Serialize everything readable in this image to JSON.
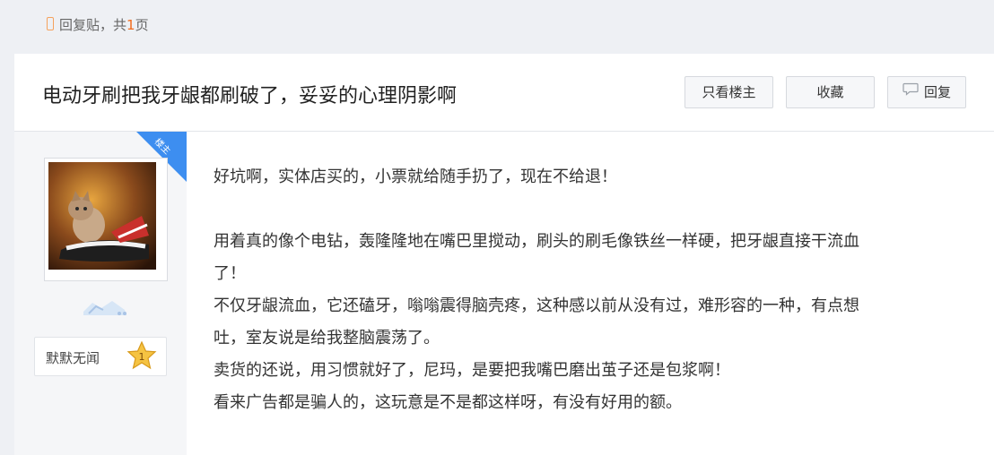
{
  "topbar": {
    "reply_prefix": "回复贴，共",
    "page_count": "1",
    "page_suffix": "页"
  },
  "post": {
    "title": "电动牙刷把我牙龈都刷破了，妥妥的心理阴影啊",
    "buttons": {
      "only_op": "只看楼主",
      "collect": "收藏",
      "reply": "回复"
    },
    "op_badge": "楼主",
    "author": {
      "username": "默默无闻",
      "level": "1"
    },
    "paragraphs": [
      "好坑啊，实体店买的，小票就给随手扔了，现在不给退！",
      "用着真的像个电钻，轰隆隆地在嘴巴里搅动，刷头的刷毛像铁丝一样硬，把牙龈直接干流血",
      "了！",
      "不仅牙龈流血，它还磕牙，嗡嗡震得脑壳疼，这种感以前从没有过，难形容的一种，有点想",
      "吐，室友说是给我整脑震荡了。",
      "卖货的还说，用习惯就好了，尼玛，是要把我嘴巴磨出茧子还是包浆啊！",
      "看来广告都是骗人的，这玩意是不是都这样呀，有没有好用的额。"
    ]
  },
  "colors": {
    "accent_orange": "#f26a1b",
    "ribbon_blue": "#3d8ef0",
    "badge_gold": "#f5c342"
  },
  "icons": [
    "reply-bubble-icon",
    "level-badge-icon",
    "level-star-icon",
    "avatar"
  ]
}
